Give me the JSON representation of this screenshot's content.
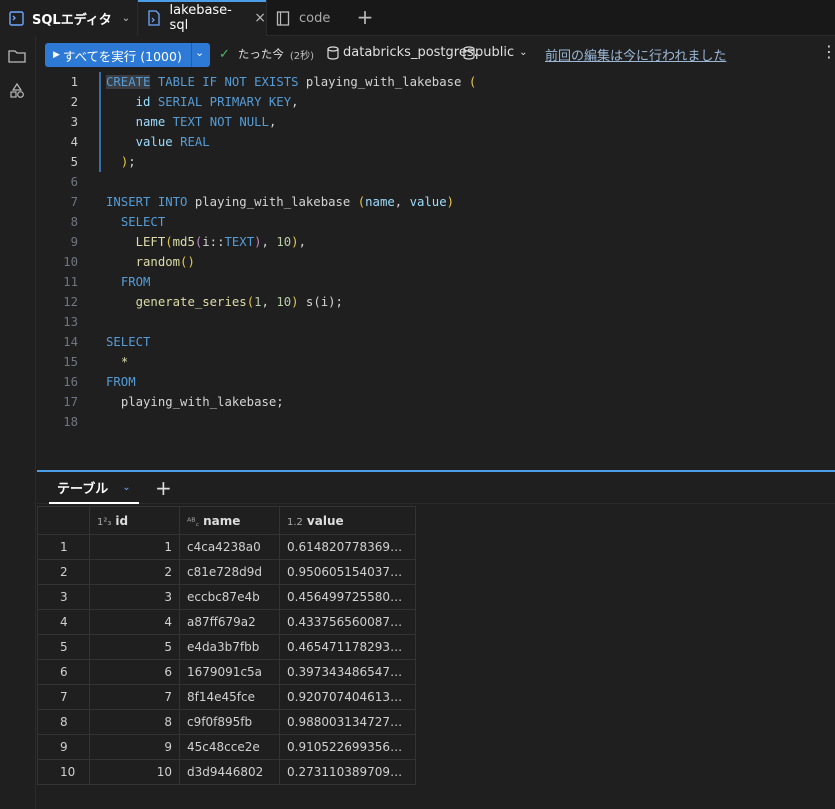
{
  "tabs": [
    {
      "label": "SQLエディタ"
    },
    {
      "label": "lakebase-sql"
    },
    {
      "label": "code"
    }
  ],
  "toolbar": {
    "run_label": "すべてを実行 (1000)",
    "status_text": "たった今",
    "status_duration": "(2秒)",
    "catalog": "databricks_postgres.",
    "schema": "public",
    "last_edit": "前回の編集は今に行われました"
  },
  "editor": {
    "lines": [
      {
        "n": "1",
        "tokens": [
          [
            "kw hl",
            "CREATE"
          ],
          [
            "op",
            " "
          ],
          [
            "kw",
            "TABLE"
          ],
          [
            "op",
            " "
          ],
          [
            "kw",
            "IF"
          ],
          [
            "op",
            " "
          ],
          [
            "kw",
            "NOT"
          ],
          [
            "op",
            " "
          ],
          [
            "kw",
            "EXISTS"
          ],
          [
            "id",
            " playing_with_lakebase "
          ],
          [
            "paren",
            "("
          ]
        ]
      },
      {
        "n": "2",
        "tokens": [
          [
            "op",
            "    "
          ],
          [
            "col",
            "id"
          ],
          [
            "op",
            " "
          ],
          [
            "kw",
            "SERIAL PRIMARY KEY"
          ],
          [
            "op",
            ","
          ]
        ]
      },
      {
        "n": "3",
        "tokens": [
          [
            "op",
            "    "
          ],
          [
            "col",
            "name"
          ],
          [
            "op",
            " "
          ],
          [
            "kw",
            "TEXT"
          ],
          [
            "op",
            " "
          ],
          [
            "kw",
            "NOT"
          ],
          [
            "op",
            " "
          ],
          [
            "kw",
            "NULL"
          ],
          [
            "op",
            ","
          ]
        ]
      },
      {
        "n": "4",
        "tokens": [
          [
            "op",
            "    "
          ],
          [
            "col",
            "value"
          ],
          [
            "op",
            " "
          ],
          [
            "kw",
            "REAL"
          ]
        ]
      },
      {
        "n": "5",
        "tokens": [
          [
            "op",
            "  "
          ],
          [
            "paren",
            ")"
          ],
          [
            "op",
            ";"
          ]
        ]
      },
      {
        "n": "6",
        "tokens": []
      },
      {
        "n": "7",
        "tokens": [
          [
            "kw",
            "INSERT"
          ],
          [
            "op",
            " "
          ],
          [
            "kw",
            "INTO"
          ],
          [
            "id",
            " playing_with_lakebase "
          ],
          [
            "paren",
            "("
          ],
          [
            "col",
            "name"
          ],
          [
            "op",
            ", "
          ],
          [
            "col",
            "value"
          ],
          [
            "paren",
            ")"
          ]
        ]
      },
      {
        "n": "8",
        "tokens": [
          [
            "op",
            "  "
          ],
          [
            "kw",
            "SELECT"
          ]
        ]
      },
      {
        "n": "9",
        "tokens": [
          [
            "op",
            "    "
          ],
          [
            "fn",
            "LEFT"
          ],
          [
            "paren",
            "("
          ],
          [
            "fn",
            "md5"
          ],
          [
            "typ",
            "("
          ],
          [
            "id",
            "i::"
          ],
          [
            "kw",
            "TEXT"
          ],
          [
            "typ",
            ")"
          ],
          [
            "op",
            ", "
          ],
          [
            "num",
            "10"
          ],
          [
            "paren",
            ")"
          ],
          [
            "op",
            ","
          ]
        ]
      },
      {
        "n": "10",
        "tokens": [
          [
            "op",
            "    "
          ],
          [
            "fn",
            "random"
          ],
          [
            "paren",
            "()"
          ]
        ]
      },
      {
        "n": "11",
        "tokens": [
          [
            "op",
            "  "
          ],
          [
            "kw",
            "FROM"
          ]
        ]
      },
      {
        "n": "12",
        "tokens": [
          [
            "op",
            "    "
          ],
          [
            "fn",
            "generate_series"
          ],
          [
            "paren",
            "("
          ],
          [
            "num",
            "1"
          ],
          [
            "op",
            ", "
          ],
          [
            "num",
            "10"
          ],
          [
            "paren",
            ")"
          ],
          [
            "id",
            " s(i);"
          ]
        ]
      },
      {
        "n": "13",
        "tokens": []
      },
      {
        "n": "14",
        "tokens": [
          [
            "kw",
            "SELECT"
          ]
        ]
      },
      {
        "n": "15",
        "tokens": [
          [
            "op",
            "  "
          ],
          [
            "fn",
            "*"
          ]
        ]
      },
      {
        "n": "16",
        "tokens": [
          [
            "kw",
            "FROM"
          ]
        ]
      },
      {
        "n": "17",
        "tokens": [
          [
            "op",
            "  "
          ],
          [
            "id",
            "playing_with_lakebase;"
          ]
        ]
      },
      {
        "n": "18",
        "tokens": []
      }
    ]
  },
  "results": {
    "tab_label": "テーブル",
    "columns": [
      {
        "label": "",
        "type_icon": ""
      },
      {
        "label": "id",
        "type_icon": "1²₃"
      },
      {
        "label": "name",
        "type_icon": "ᴬᴮ꜀"
      },
      {
        "label": "value",
        "type_icon": "1.2"
      }
    ],
    "rows": [
      [
        "1",
        "1",
        "c4ca4238a0",
        "0.6148207783699036"
      ],
      [
        "2",
        "2",
        "c81e728d9d",
        "0.9506051540374756"
      ],
      [
        "3",
        "3",
        "eccbc87e4b",
        "0.456499725580215..."
      ],
      [
        "4",
        "4",
        "a87ff679a2",
        "0.433756560087204"
      ],
      [
        "5",
        "5",
        "e4da3b7fbb",
        "0.465471178293228..."
      ],
      [
        "6",
        "6",
        "1679091c5a",
        "0.3973434865474701"
      ],
      [
        "7",
        "7",
        "8f14e45fce",
        "0.9207074046134949"
      ],
      [
        "8",
        "8",
        "c9f0f895fb",
        "0.988003134727478"
      ],
      [
        "9",
        "9",
        "45c48cce2e",
        "0.9105226993560791"
      ],
      [
        "10",
        "10",
        "d3d9446802",
        "0.273110389709472..."
      ]
    ]
  },
  "colors": {
    "accent": "#2d7ad6",
    "keyword": "#569cd6",
    "function": "#dcdcaa",
    "number": "#b5cea8",
    "success": "#4cbb6c"
  }
}
